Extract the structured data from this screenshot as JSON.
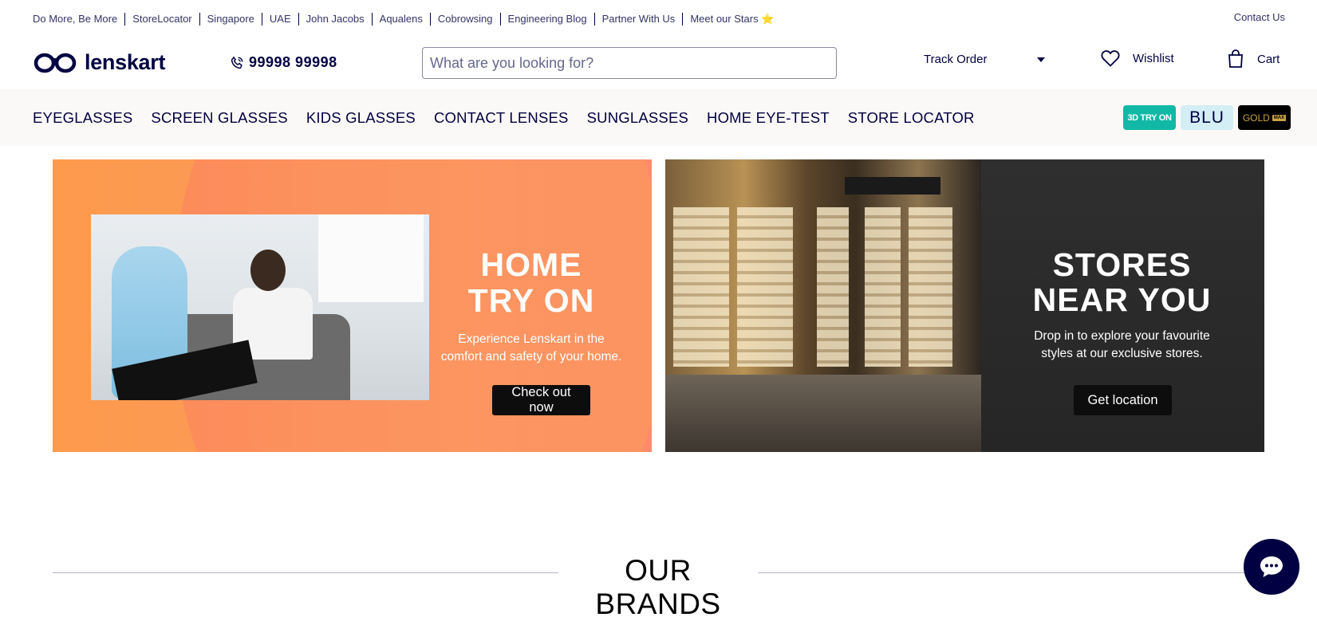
{
  "top_links": [
    "Do More, Be More",
    "StoreLocator",
    "Singapore",
    "UAE",
    "John Jacobs",
    "Aqualens",
    "Cobrowsing",
    "Engineering Blog",
    "Partner With Us",
    "Meet our Stars ⭐"
  ],
  "contact_label": "Contact Us",
  "header": {
    "logo_text": "lenskart",
    "phone": "99998 99998",
    "search_placeholder": "What are you looking for?",
    "track_order": "Track Order",
    "wishlist": "Wishlist",
    "cart": "Cart"
  },
  "nav": {
    "items": [
      "EYEGLASSES",
      "SCREEN GLASSES",
      "KIDS GLASSES",
      "CONTACT LENSES",
      "SUNGLASSES",
      "HOME EYE-TEST",
      "STORE LOCATOR"
    ],
    "badges": {
      "try_on": "3D TRY ON",
      "blu": "BLU",
      "gold": "GOLD",
      "gold_tag": "MAX"
    }
  },
  "banners": {
    "home": {
      "title_line1": "HOME",
      "title_line2": "TRY ON",
      "subtitle_line1": "Experience Lenskart in the",
      "subtitle_line2": "comfort and safety of your home.",
      "cta": "Check out now"
    },
    "stores": {
      "title_line1": "STORES",
      "title_line2": "NEAR YOU",
      "subtitle_line1": "Drop in to explore your favourite",
      "subtitle_line2": "styles at our exclusive stores.",
      "cta": "Get location"
    }
  },
  "brands_title": "OUR BRANDS",
  "colors": {
    "brand_navy": "#000042",
    "teal": "#11b8a6",
    "chat_bg": "#000042"
  },
  "icons": {
    "phone": "phone-icon",
    "heart": "heart-icon",
    "bag": "bag-icon",
    "dropdown": "caret-down-icon",
    "chat": "chat-icon"
  }
}
